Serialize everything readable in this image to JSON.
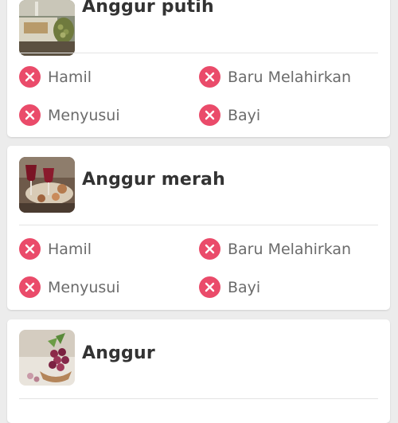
{
  "foods": [
    {
      "name": "Anggur putih",
      "thumbnail_icon": "white-wine-photo",
      "statuses": [
        {
          "label": "Hamil",
          "allowed": false,
          "icon": "close-circle-icon"
        },
        {
          "label": "Baru Melahirkan",
          "allowed": false,
          "icon": "close-circle-icon"
        },
        {
          "label": "Menyusui",
          "allowed": false,
          "icon": "close-circle-icon"
        },
        {
          "label": "Bayi",
          "allowed": false,
          "icon": "close-circle-icon"
        }
      ]
    },
    {
      "name": "Anggur merah",
      "thumbnail_icon": "red-wine-photo",
      "statuses": [
        {
          "label": "Hamil",
          "allowed": false,
          "icon": "close-circle-icon"
        },
        {
          "label": "Baru Melahirkan",
          "allowed": false,
          "icon": "close-circle-icon"
        },
        {
          "label": "Menyusui",
          "allowed": false,
          "icon": "close-circle-icon"
        },
        {
          "label": "Bayi",
          "allowed": false,
          "icon": "close-circle-icon"
        }
      ]
    },
    {
      "name": "Anggur",
      "thumbnail_icon": "grapes-photo",
      "statuses": []
    }
  ],
  "colors": {
    "not_allowed": "#ea4b6a",
    "background": "#ececec",
    "card": "#ffffff"
  }
}
